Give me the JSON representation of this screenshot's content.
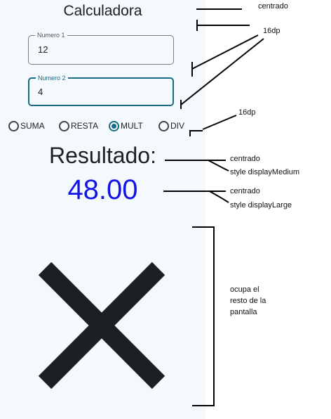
{
  "app": {
    "title": "Calculadora"
  },
  "fields": [
    {
      "label": "Numero 1",
      "value": "12"
    },
    {
      "label": "Numero 2",
      "value": "4"
    }
  ],
  "operations": [
    {
      "label": "SUMA",
      "selected": false
    },
    {
      "label": "RESTA",
      "selected": false
    },
    {
      "label": "MULT",
      "selected": true
    },
    {
      "label": "DIV",
      "selected": false
    }
  ],
  "result": {
    "label": "Resultado:",
    "value": "48.00"
  },
  "image": {
    "icon": "close-x-icon",
    "color": "#1c1f23"
  },
  "annotations": {
    "centrado_1": "centrado",
    "dp_1": "16dp",
    "dp_2": "16dp",
    "centrado_2": "centrado",
    "style_medium": "style displayMedium",
    "centrado_3": "centrado",
    "style_large": "style displayLarge",
    "resto": "ocupa el resto de la pantalla"
  },
  "colors": {
    "primary": "#1a6a83",
    "result": "#1414e6",
    "background": "#f4f9fd"
  }
}
